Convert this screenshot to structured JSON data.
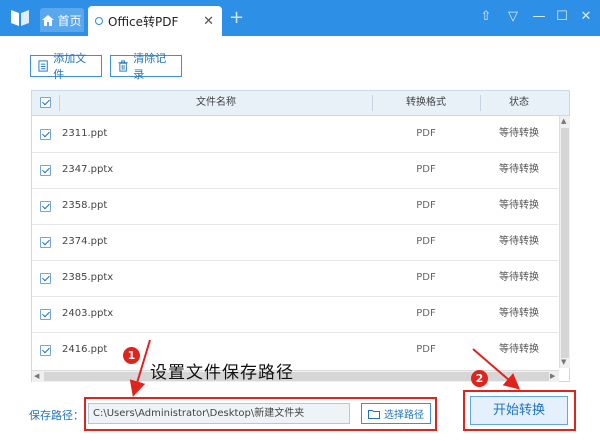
{
  "titlebar": {
    "home_label": "首页",
    "doc_tab_label": "Office转PDF",
    "close_glyph": "✕",
    "new_tab_glyph": "+",
    "skin_glyph": "⇧",
    "menu_glyph": "▽",
    "minimize_glyph": "—",
    "maximize_glyph": "☐",
    "close_window_glyph": "✕",
    "accent_color": "#2d8fe6"
  },
  "toolbar": {
    "add_file_label": "添加文件",
    "clear_label": "清除记录"
  },
  "table": {
    "columns": [
      "文件名称",
      "转换格式",
      "状态"
    ],
    "rows": [
      {
        "name": "2311.ppt",
        "format": "PDF",
        "status": "等待转换"
      },
      {
        "name": "2347.pptx",
        "format": "PDF",
        "status": "等待转换"
      },
      {
        "name": "2358.ppt",
        "format": "PDF",
        "status": "等待转换"
      },
      {
        "name": "2374.ppt",
        "format": "PDF",
        "status": "等待转换"
      },
      {
        "name": "2385.pptx",
        "format": "PDF",
        "status": "等待转换"
      },
      {
        "name": "2403.pptx",
        "format": "PDF",
        "status": "等待转换"
      },
      {
        "name": "2416.ppt",
        "format": "PDF",
        "status": "等待转换"
      }
    ]
  },
  "bottom": {
    "save_label": "保存路径：",
    "path_value": "C:\\Users\\Administrator\\Desktop\\新建文件夹",
    "choose_path_label": "选择路径",
    "start_label": "开始转换"
  },
  "annotations": {
    "badge_1": "1",
    "badge_2": "2",
    "hint_text": "设置文件保存路径",
    "highlight_color": "#e0231c"
  }
}
